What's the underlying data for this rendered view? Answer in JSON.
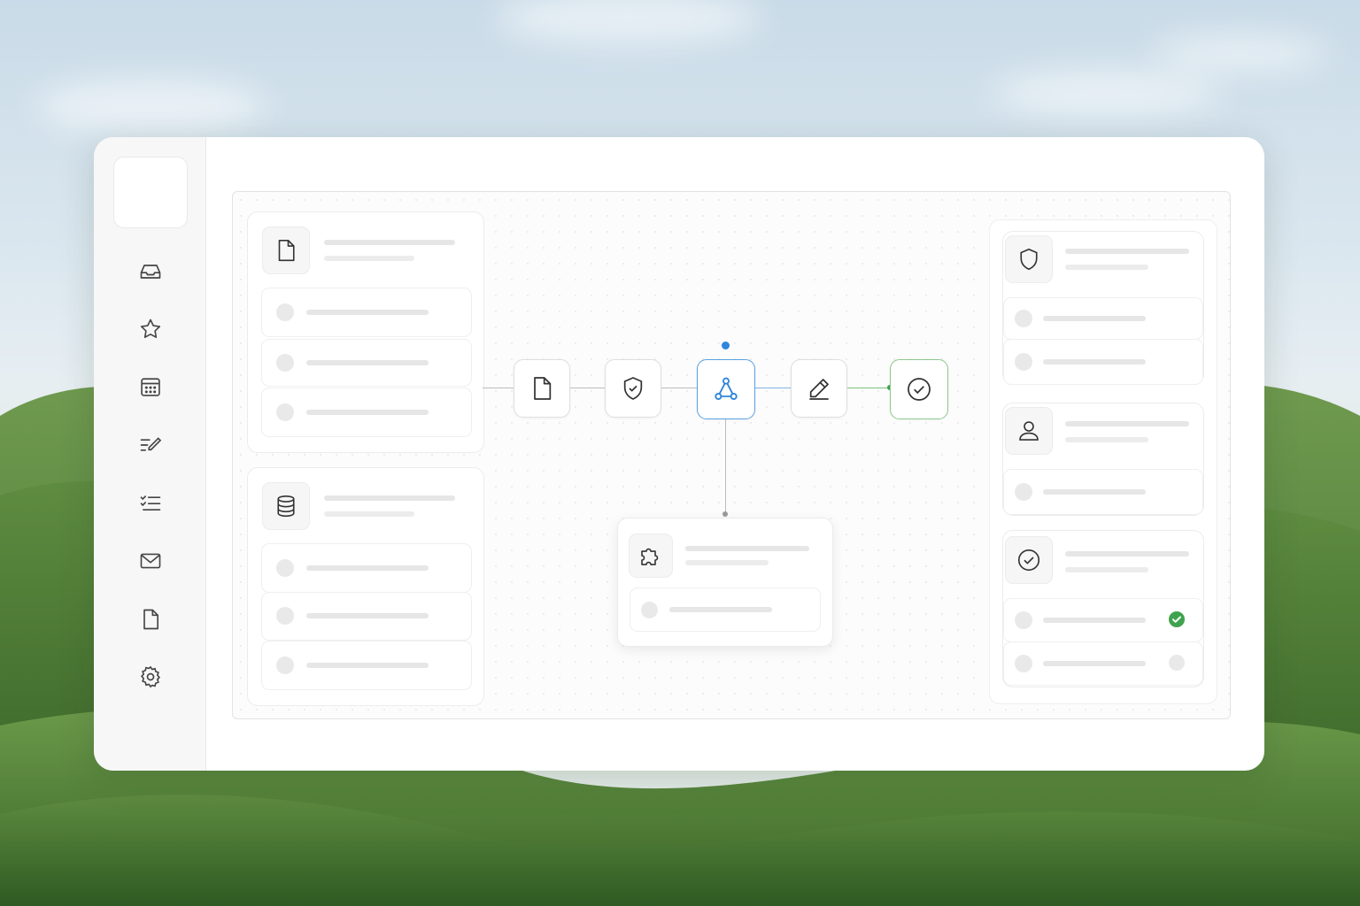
{
  "colors": {
    "accent": "#2f86db",
    "success": "#3fa34d",
    "icon": "#333333",
    "muted": "#e6e6e6"
  },
  "sidebar": {
    "items": [
      {
        "icon": "inbox-icon"
      },
      {
        "icon": "star-icon"
      },
      {
        "icon": "calendar-icon"
      },
      {
        "icon": "edit-list-icon"
      },
      {
        "icon": "checklist-icon"
      },
      {
        "icon": "mail-icon"
      },
      {
        "icon": "document-icon"
      },
      {
        "icon": "gear-icon"
      }
    ]
  },
  "workflow": {
    "nodes": [
      {
        "icon": "document-icon",
        "state": "default"
      },
      {
        "icon": "shield-check-icon",
        "state": "default"
      },
      {
        "icon": "workflow-icon",
        "state": "active"
      },
      {
        "icon": "pencil-icon",
        "state": "default"
      },
      {
        "icon": "check-circle-icon",
        "state": "done"
      }
    ],
    "plugin_card": {
      "icon": "puzzle-icon"
    }
  },
  "left_panels": [
    {
      "icon": "document-icon",
      "rows": 3
    },
    {
      "icon": "database-icon",
      "rows": 3
    }
  ],
  "right_panels": [
    {
      "icon": "shield-icon",
      "rows": 2
    },
    {
      "icon": "user-icon",
      "rows": 1
    },
    {
      "icon": "check-circle-icon",
      "rows": 2,
      "row_status": [
        "complete",
        "pending"
      ]
    }
  ]
}
